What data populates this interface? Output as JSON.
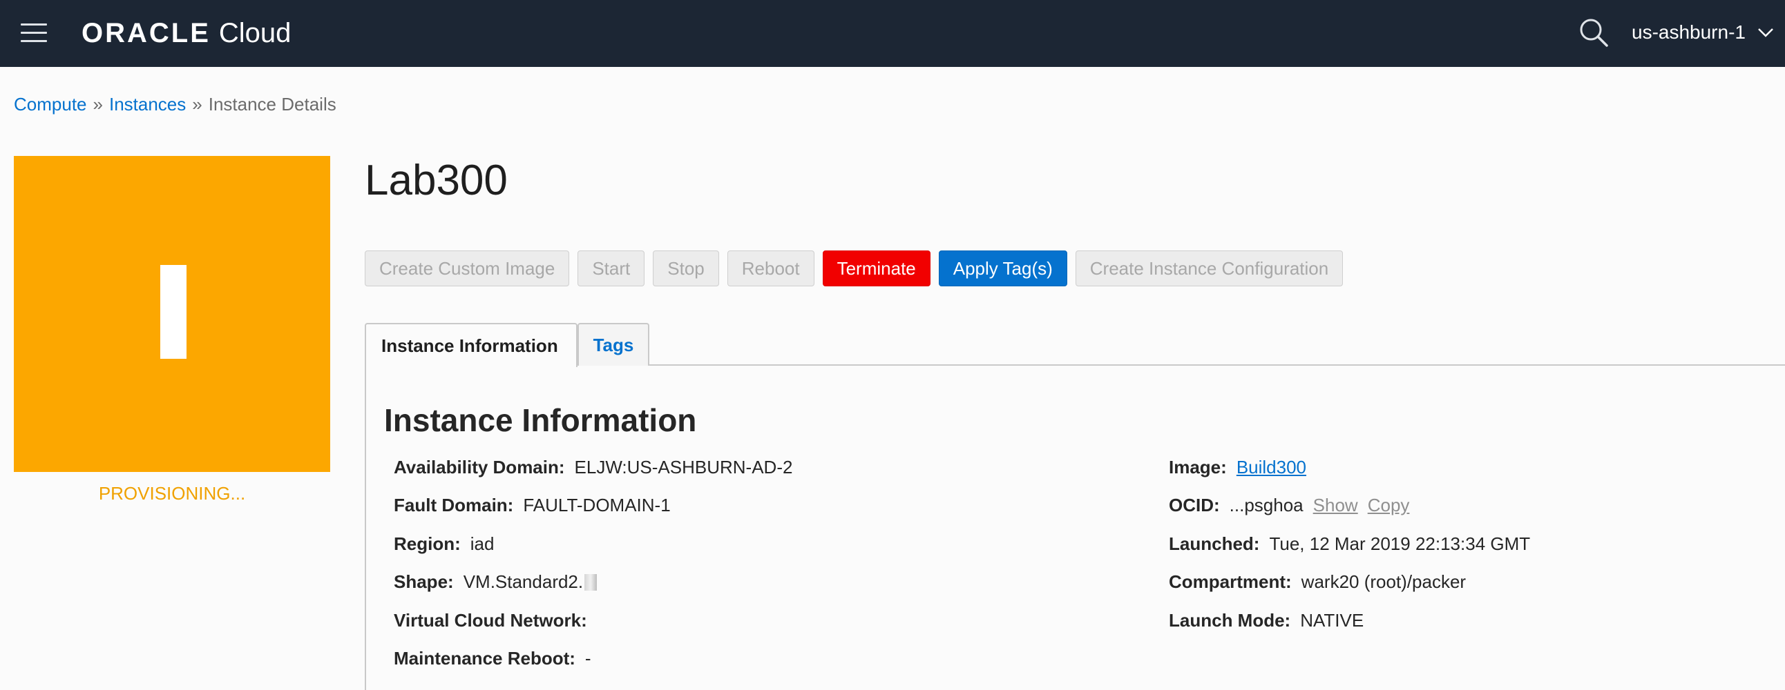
{
  "nav": {
    "logo_brand": "ORACLE",
    "logo_product": "Cloud",
    "region": "us-ashburn-1"
  },
  "breadcrumb": {
    "items": [
      "Compute",
      "Instances",
      "Instance Details"
    ],
    "separator": "»"
  },
  "status": {
    "label": "PROVISIONING...",
    "tile_color": "#fca700"
  },
  "instance": {
    "name": "Lab300"
  },
  "actions": {
    "create_custom_image": "Create Custom Image",
    "start": "Start",
    "stop": "Stop",
    "reboot": "Reboot",
    "terminate": "Terminate",
    "apply_tags": "Apply Tag(s)",
    "create_instance_configuration": "Create Instance Configuration"
  },
  "tabs": {
    "instance_information": "Instance Information",
    "tags": "Tags"
  },
  "info": {
    "section_title": "Instance Information",
    "availability_domain": {
      "label": "Availability Domain:",
      "value": "ELJW:US-ASHBURN-AD-2"
    },
    "fault_domain": {
      "label": "Fault Domain:",
      "value": "FAULT-DOMAIN-1"
    },
    "region": {
      "label": "Region:",
      "value": "iad"
    },
    "shape": {
      "label": "Shape:",
      "value": "VM.Standard2."
    },
    "vcn": {
      "label": "Virtual Cloud Network:",
      "value": ""
    },
    "maintenance_reboot": {
      "label": "Maintenance Reboot:",
      "value": "-"
    },
    "image": {
      "label": "Image:",
      "value": "Build300"
    },
    "ocid": {
      "label": "OCID:",
      "value": "...psghoa",
      "show": "Show",
      "copy": "Copy"
    },
    "launched": {
      "label": "Launched:",
      "value": "Tue, 12 Mar 2019 22:13:34 GMT"
    },
    "compartment": {
      "label": "Compartment:",
      "value": "wark20 (root)/packer"
    },
    "launch_mode": {
      "label": "Launch Mode:",
      "value": "NATIVE"
    }
  },
  "colors": {
    "nav_bg": "#1c2634",
    "link": "#0572ce",
    "danger": "#f10000",
    "provisioning": "#fca700"
  }
}
